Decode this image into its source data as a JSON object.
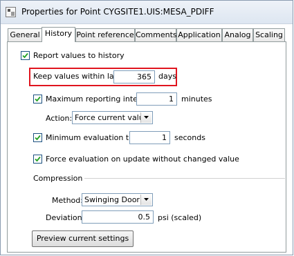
{
  "window": {
    "title": "Properties for Point CYGSITE1.UIS:MESA_PDIFF"
  },
  "tabs": [
    {
      "label": "General"
    },
    {
      "label": "History"
    },
    {
      "label": "Point reference"
    },
    {
      "label": "Comments"
    },
    {
      "label": "Application"
    },
    {
      "label": "Analog"
    },
    {
      "label": "Scaling"
    }
  ],
  "active_tab": "History",
  "history": {
    "report_to_history": {
      "label": "Report values to history",
      "checked": true
    },
    "keep_within": {
      "label": "Keep values within last:",
      "value": "365",
      "unit": "days"
    },
    "max_interval": {
      "label": "Maximum reporting interval:",
      "value": "1",
      "unit": "minutes",
      "checked": true
    },
    "action": {
      "label": "Action:",
      "value": "Force current value"
    },
    "min_eval": {
      "label": "Minimum evaluation time:",
      "value": "1",
      "unit": "seconds",
      "checked": true
    },
    "force_eval": {
      "label": "Force evaluation on update without changed value",
      "checked": true
    },
    "compression": {
      "heading": "Compression",
      "method_label": "Method:",
      "method_value": "Swinging Door",
      "deviation_label": "Deviation:",
      "deviation_value": "0.5",
      "deviation_unit": "psi (scaled)"
    },
    "preview_button": "Preview current settings"
  },
  "colors": {
    "highlight_border": "#e0141e",
    "input_border": "#7f9db9"
  }
}
